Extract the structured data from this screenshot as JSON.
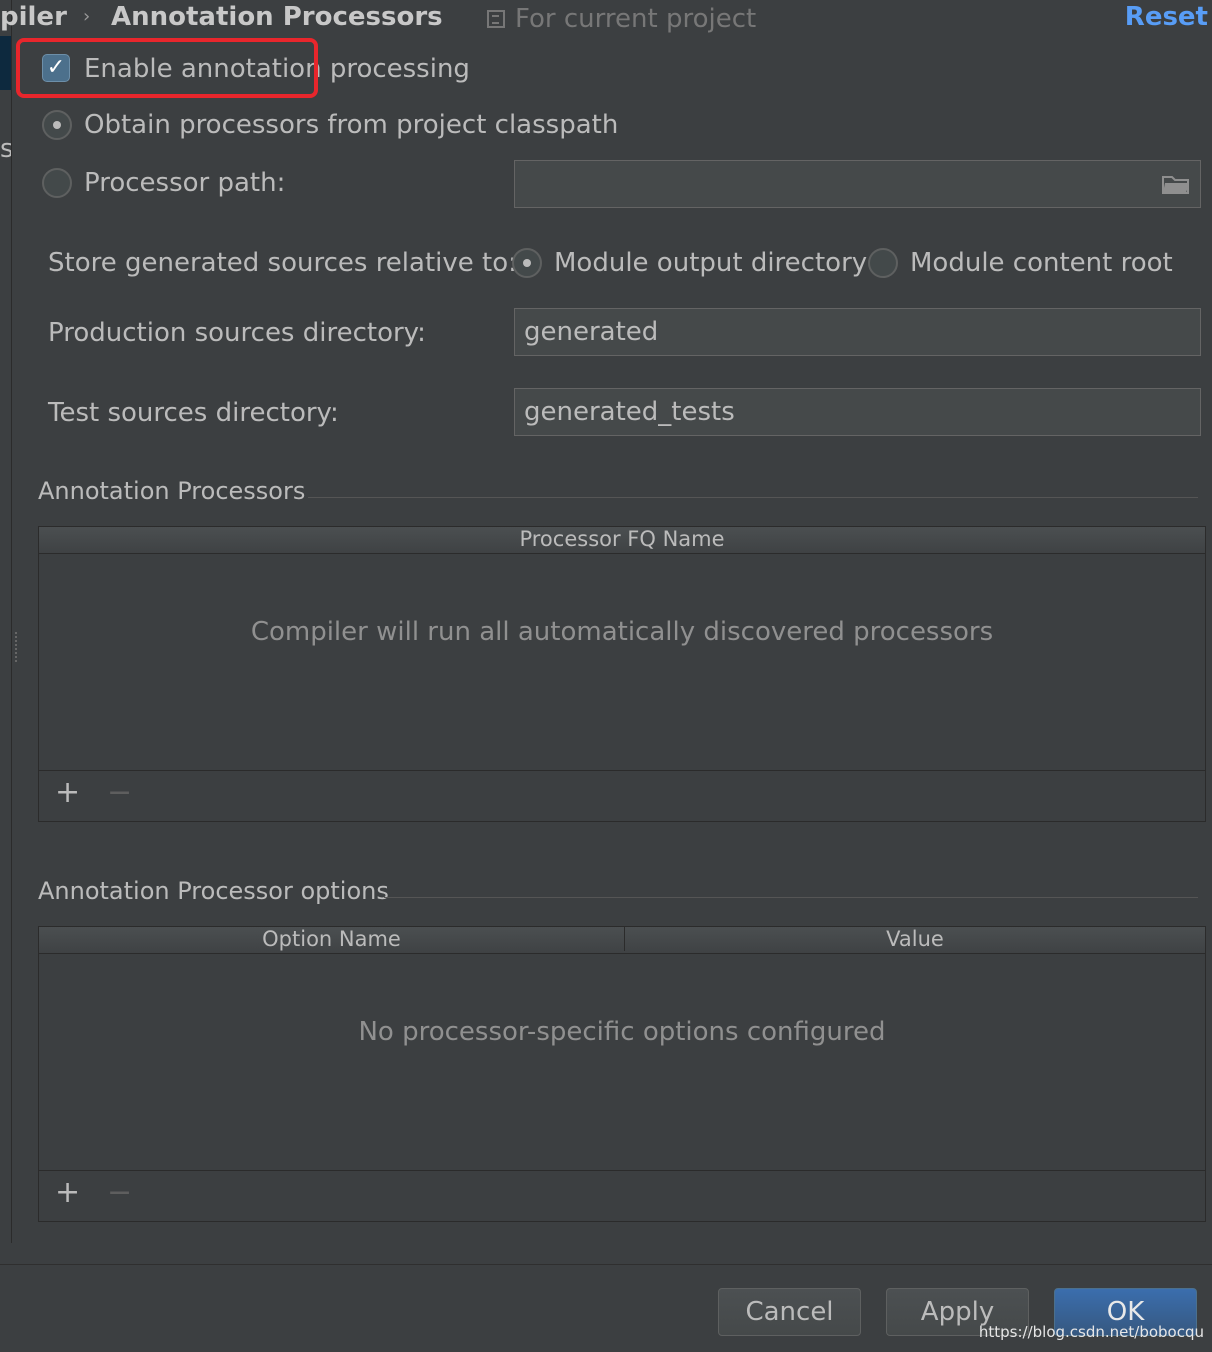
{
  "breadcrumb": {
    "parent": "piler",
    "separator": "›",
    "current": "Annotation Processors"
  },
  "scope_label": "For current project",
  "reset_label": "Reset",
  "left_sidebar_fragment": "s",
  "enable_checkbox": {
    "label": "Enable annotation processing",
    "checked": true
  },
  "obtain_from_classpath": {
    "label": "Obtain processors from project classpath",
    "selected": true
  },
  "processor_path": {
    "label": "Processor path:",
    "selected": false,
    "value": ""
  },
  "store_generated": {
    "label": "Store generated sources relative to:",
    "option_module_output": "Module output directory",
    "option_content_root": "Module content root",
    "selected": "Module output directory"
  },
  "production_dir": {
    "label": "Production sources directory:",
    "value": "generated"
  },
  "test_dir": {
    "label": "Test sources directory:",
    "value": "generated_tests"
  },
  "annotation_processors": {
    "title": "Annotation Processors",
    "column": "Processor FQ Name",
    "empty_text": "Compiler will run all automatically discovered processors",
    "add_label": "+",
    "remove_label": "−"
  },
  "processor_options": {
    "title": "Annotation Processor options",
    "columns": [
      "Option Name",
      "Value"
    ],
    "empty_text": "No processor-specific options configured",
    "add_label": "+",
    "remove_label": "−"
  },
  "buttons": {
    "cancel": "Cancel",
    "apply": "Apply",
    "ok": "OK"
  },
  "watermark": "https://blog.csdn.net/bobocqu",
  "colors": {
    "background": "#3c3f41",
    "accent": "#589df6",
    "highlight_box": "#e8262c"
  }
}
